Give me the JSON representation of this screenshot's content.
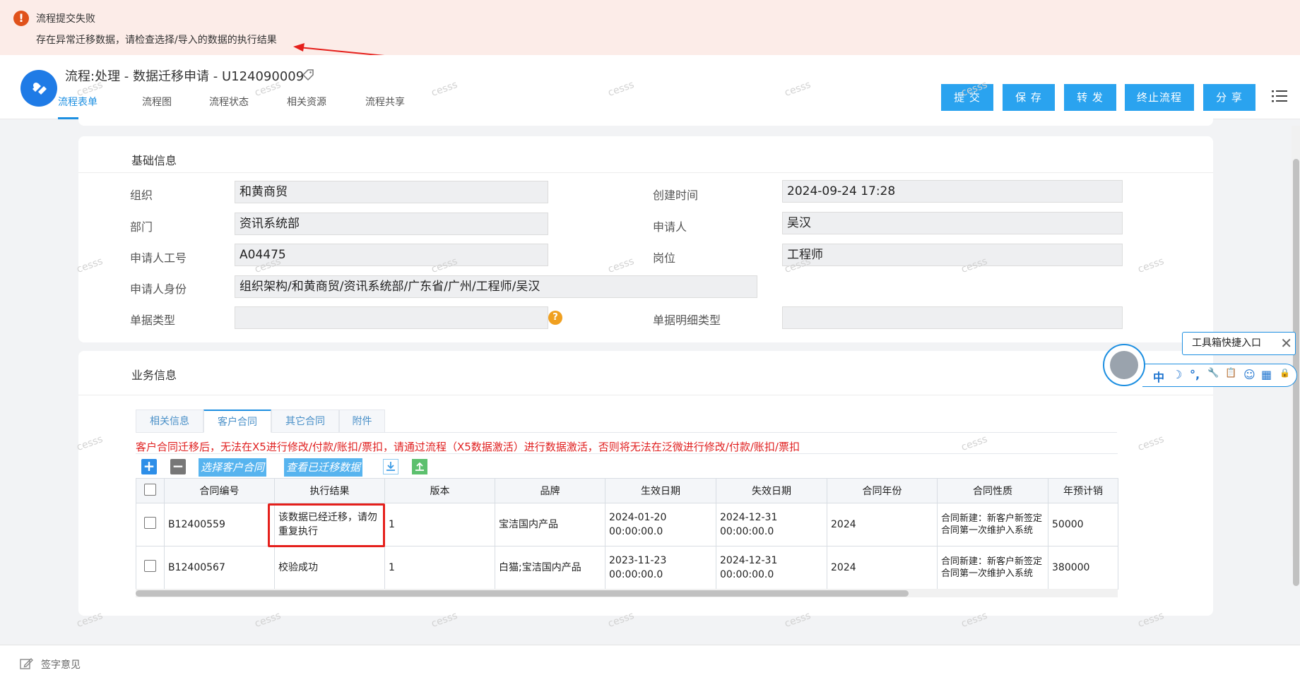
{
  "notice": {
    "title": "流程提交失败",
    "message": "存在异常迁移数据，请检查选择/导入的数据的执行结果"
  },
  "header": {
    "title": "流程:处理 - 数据迁移申请 - U124090009",
    "tabs": [
      "流程表单",
      "流程图",
      "流程状态",
      "相关资源",
      "流程共享"
    ],
    "active_tab": "流程表单",
    "buttons": [
      "提 交",
      "保 存",
      "转 发",
      "终止流程",
      "分 享"
    ]
  },
  "basic": {
    "title": "基础信息",
    "org_label": "组织",
    "org_value": "和黄商贸",
    "dept_label": "部门",
    "dept_value": "资讯系统部",
    "empno_label": "申请人工号",
    "empno_value": "A04475",
    "identity_label": "申请人身份",
    "identity_value": "组织架构/和黄商贸/资讯系统部/广东省/广州/工程师/吴汉",
    "doctype_label": "单据类型",
    "doctype_value": "",
    "created_label": "创建时间",
    "created_value": "2024-09-24 17:28",
    "applicant_label": "申请人",
    "applicant_value": "吴汉",
    "position_label": "岗位",
    "position_value": "工程师",
    "detailtype_label": "单据明细类型",
    "detailtype_value": ""
  },
  "business": {
    "title": "业务信息",
    "tabs": [
      "相关信息",
      "客户合同",
      "其它合同",
      "附件"
    ],
    "active_tab": "客户合同",
    "warning": "客户合同迁移后，无法在X5进行修改/付款/账扣/票扣，请通过流程（X5数据激活）进行数据激活，否则将无法在泛微进行修改/付款/账扣/票扣",
    "toolbar": {
      "select_label": "选择客户合同",
      "view_label": "查看已迁移数据"
    },
    "columns": [
      "合同编号",
      "执行结果",
      "版本",
      "品牌",
      "生效日期",
      "失效日期",
      "合同年份",
      "合同性质",
      "年预计销"
    ],
    "rows": [
      {
        "no": "B12400559",
        "result": "该数据已经迁移，请勿重复执行",
        "version": "1",
        "brand": "宝洁国内产品",
        "start": "2024-01-20 00:00:00.0",
        "end": "2024-12-31 00:00:00.0",
        "year": "2024",
        "nature": "合同新建：新客户新签定合同第一次维护入系统",
        "forecast": "50000"
      },
      {
        "no": "B12400567",
        "result": "校验成功",
        "version": "1",
        "brand": "白猫;宝洁国内产品",
        "start": "2023-11-23 00:00:00.0",
        "end": "2024-12-31 00:00:00.0",
        "year": "2024",
        "nature": "合同新建：新客户新签定合同第一次维护入系统",
        "forecast": "380000"
      }
    ]
  },
  "footer": {
    "label": "签字意见"
  },
  "toolbox": {
    "tooltip": "工具箱快捷入口",
    "items": [
      "中",
      "☽",
      "°,",
      "🔧",
      "📋",
      "☺",
      "▦",
      "🔒"
    ]
  },
  "watermark": "cesss",
  "colors": {
    "accent": "#2aa3ef",
    "error": "#e02020",
    "notice_bg": "#fcece8"
  }
}
